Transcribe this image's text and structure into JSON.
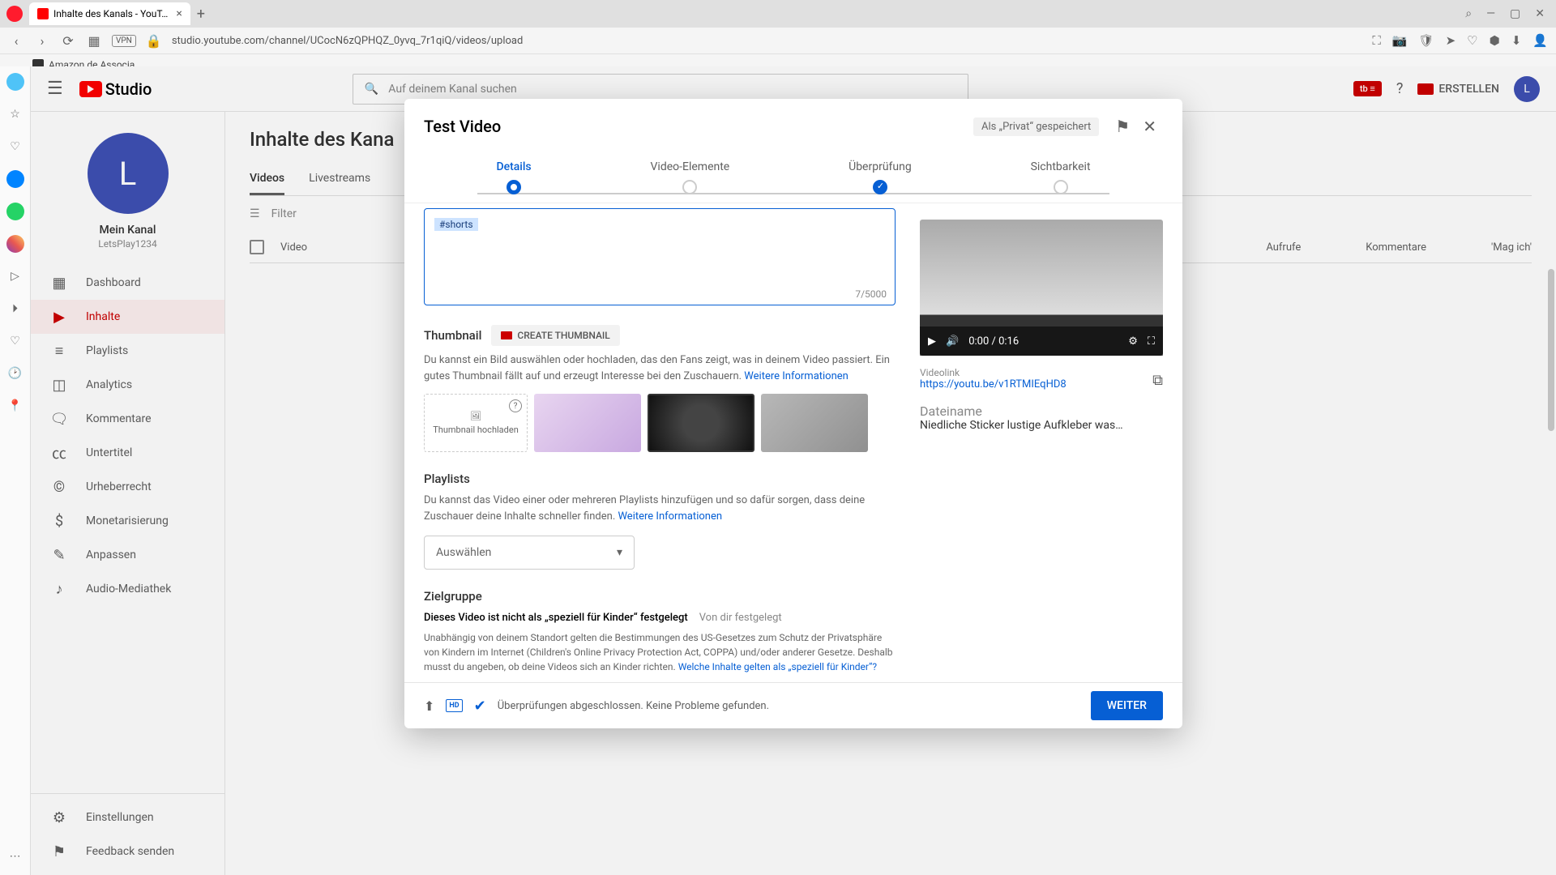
{
  "browser": {
    "tab_title": "Inhalte des Kanals - YouT…",
    "url": "studio.youtube.com/channel/UCocN6zQPHQZ_0yvq_7r1qiQ/videos/upload",
    "bookmark": "Amazon.de Associa…"
  },
  "header": {
    "logo_text": "Studio",
    "search_placeholder": "Auf deinem Kanal suchen",
    "create_label": "ERSTELLEN",
    "avatar_initial": "L"
  },
  "channel": {
    "avatar_initial": "L",
    "name": "Mein Kanal",
    "handle": "LetsPlay1234"
  },
  "sidebar": {
    "items": [
      {
        "label": "Dashboard",
        "icon": "▦"
      },
      {
        "label": "Inhalte",
        "icon": "▶",
        "active": true
      },
      {
        "label": "Playlists",
        "icon": "≡"
      },
      {
        "label": "Analytics",
        "icon": "📊"
      },
      {
        "label": "Kommentare",
        "icon": "💬"
      },
      {
        "label": "Untertitel",
        "icon": "🈯"
      },
      {
        "label": "Urheberrecht",
        "icon": "©"
      },
      {
        "label": "Monetarisierung",
        "icon": "$"
      },
      {
        "label": "Anpassen",
        "icon": "✎"
      },
      {
        "label": "Audio-Mediathek",
        "icon": "♪"
      }
    ],
    "bottom": [
      {
        "label": "Einstellungen",
        "icon": "⚙"
      },
      {
        "label": "Feedback senden",
        "icon": "⚑"
      }
    ]
  },
  "page": {
    "title": "Inhalte des Kana",
    "tabs": [
      "Videos",
      "Livestreams"
    ],
    "filter_label": "Filter",
    "columns": {
      "video": "Video",
      "views": "Aufrufe",
      "comments": "Kommentare",
      "likes": "'Mag ich'"
    }
  },
  "modal": {
    "title": "Test Video",
    "save_status": "Als „Privat“ gespeichert",
    "steps": [
      "Details",
      "Video-Elemente",
      "Überprüfung",
      "Sichtbarkeit"
    ],
    "description_tag": "#shorts",
    "char_count": "7/5000",
    "thumbnail": {
      "heading": "Thumbnail",
      "create_btn": "CREATE THUMBNAIL",
      "desc": "Du kannst ein Bild auswählen oder hochladen, das den Fans zeigt, was in deinem Video passiert. Ein gutes Thumbnail fällt auf und erzeugt Interesse bei den Zuschauern. ",
      "more_link": "Weitere Informationen",
      "upload_label": "Thumbnail hochladen"
    },
    "playlists": {
      "heading": "Playlists",
      "desc": "Du kannst das Video einer oder mehreren Playlists hinzufügen und so dafür sorgen, dass deine Zuschauer deine Inhalte schneller finden. ",
      "more_link": "Weitere Informationen",
      "select_label": "Auswählen"
    },
    "audience": {
      "heading": "Zielgruppe",
      "status_bold": "Dieses Video ist nicht als „speziell für Kinder“ festgelegt",
      "status_tag": "Von dir festgelegt",
      "desc": "Unabhängig von deinem Standort gelten die Bestimmungen des US-Gesetzes zum Schutz der Privatsphäre von Kindern im Internet (Children's Online Privacy Protection Act, COPPA) und/oder anderer Gesetze. Deshalb musst du angeben, ob deine Videos sich an Kinder richten. ",
      "desc_link": "Welche Inhalte gelten als „speziell für Kinder“?"
    },
    "preview": {
      "time": "0:00 / 0:16",
      "link_label": "Videolink",
      "link_url": "https://youtu.be/v1RTMIEqHD8",
      "file_label": "Dateiname",
      "file_name": "Niedliche Sticker lustige Aufkleber was…"
    },
    "footer": {
      "text": "Überprüfungen abgeschlossen. Keine Probleme gefunden.",
      "next": "WEITER"
    }
  }
}
